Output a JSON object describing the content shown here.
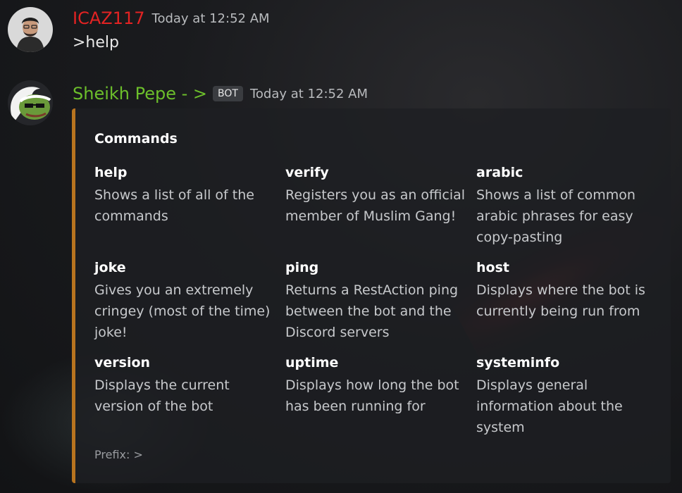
{
  "messages": {
    "user": {
      "username": "ICAZ117",
      "timestamp": "Today at 12:52 AM",
      "text": ">help"
    },
    "bot": {
      "username": "Sheikh Pepe - >",
      "tag": "BOT",
      "timestamp": "Today at 12:52 AM"
    }
  },
  "embed": {
    "title": "Commands",
    "accent_color": "#b8741f",
    "fields": [
      {
        "name": "help",
        "value": "Shows a list of all of the commands"
      },
      {
        "name": "verify",
        "value": "Registers you as an official member of Muslim Gang!"
      },
      {
        "name": "arabic",
        "value": "Shows a list of common arabic phrases for easy copy-pasting"
      },
      {
        "name": "joke",
        "value": "Gives you an extremely cringey (most of the time) joke!"
      },
      {
        "name": "ping",
        "value": "Returns a RestAction ping between the bot and the Discord servers"
      },
      {
        "name": "host",
        "value": "Displays where the bot is currently being run from"
      },
      {
        "name": "version",
        "value": "Displays the current version of the bot"
      },
      {
        "name": "uptime",
        "value": "Displays how long the bot has been running for"
      },
      {
        "name": "systeminfo",
        "value": "Displays general information about the system"
      }
    ],
    "footer": "Prefix: >"
  },
  "colors": {
    "user_name": "#e32323",
    "bot_name": "#6cbf2b",
    "background": "#1a1b1e"
  },
  "icons": {
    "user_avatar": "user-avatar-icon",
    "bot_avatar": "pepe-avatar-icon"
  }
}
